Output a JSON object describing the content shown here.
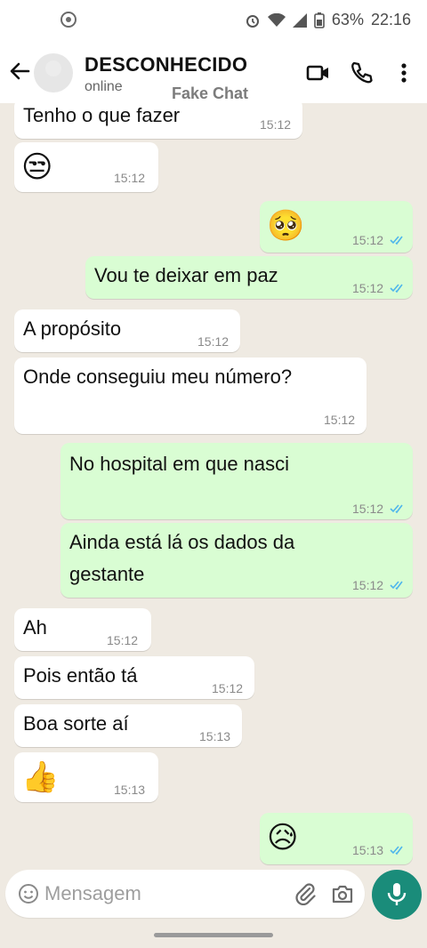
{
  "status_bar": {
    "battery": "63%",
    "time": "22:16"
  },
  "header": {
    "contact_name": "DESCONHECIDO",
    "contact_status": "online",
    "watermark": "Fake Chat"
  },
  "messages": [
    {
      "direction": "incoming",
      "text": "Tenho o que fazer",
      "time": "15:12"
    },
    {
      "direction": "incoming",
      "emoji": "😒",
      "time": "15:12"
    },
    {
      "direction": "outgoing",
      "emoji": "🥺",
      "time": "15:12",
      "read": true
    },
    {
      "direction": "outgoing",
      "text": "Vou te deixar em paz",
      "time": "15:12",
      "read": true
    },
    {
      "direction": "incoming",
      "text": "A propósito",
      "time": "15:12"
    },
    {
      "direction": "incoming",
      "text": "Onde conseguiu meu número?",
      "time": "15:12"
    },
    {
      "direction": "outgoing",
      "text": "No hospital em que nasci",
      "time": "15:12",
      "read": true
    },
    {
      "direction": "outgoing",
      "text": "Ainda está lá os dados da",
      "text2": "gestante",
      "time": "15:12",
      "read": true
    },
    {
      "direction": "incoming",
      "text": "Ah",
      "time": "15:12"
    },
    {
      "direction": "incoming",
      "text": "Pois então tá",
      "time": "15:12"
    },
    {
      "direction": "incoming",
      "text": "Boa sorte aí",
      "time": "15:13"
    },
    {
      "direction": "incoming",
      "emoji": "👍",
      "time": "15:13"
    },
    {
      "direction": "outgoing",
      "emoji": "😥",
      "time": "15:13",
      "read": true
    }
  ],
  "composer": {
    "placeholder": "Mensagem"
  },
  "colors": {
    "outgoing_bubble": "#d9fdd3",
    "incoming_bubble": "#ffffff",
    "read_ticks": "#4fb6ec",
    "mic_button": "#1a8c7a"
  }
}
